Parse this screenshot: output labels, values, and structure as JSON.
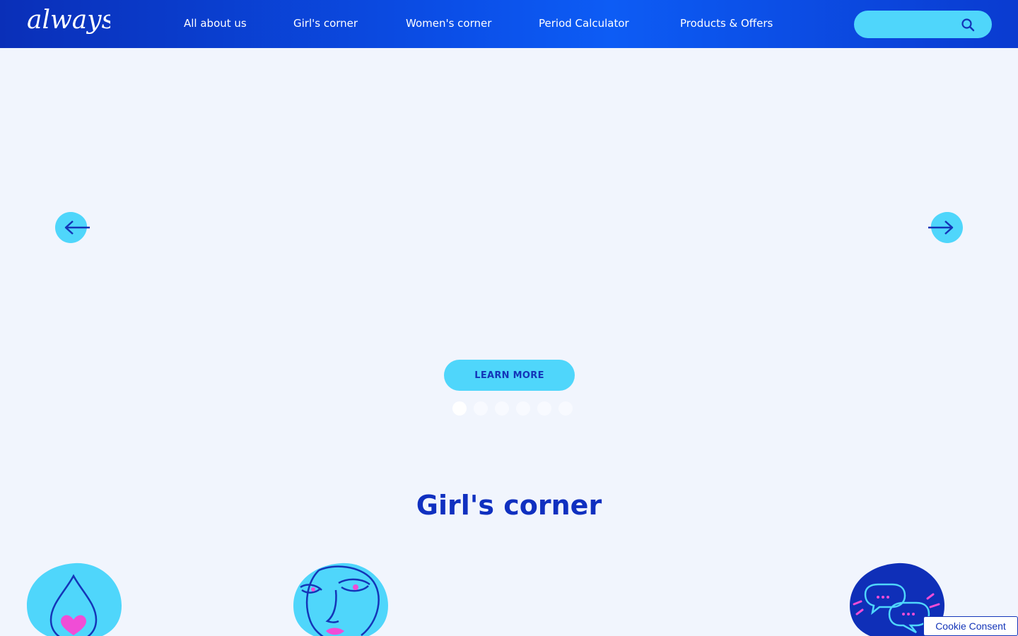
{
  "brand": {
    "logo_text": "always"
  },
  "nav": {
    "items": [
      {
        "label": "All about us"
      },
      {
        "label": "Girl's corner"
      },
      {
        "label": "Women's corner"
      },
      {
        "label": "Period Calculator"
      },
      {
        "label": "Products & Offers"
      }
    ]
  },
  "search": {
    "placeholder": ""
  },
  "hero": {
    "cta_label": "LEARN MORE",
    "slide_count": 6,
    "active_slide": 1
  },
  "section": {
    "title": "Girl's corner"
  },
  "cookie": {
    "label": "Cookie Consent"
  },
  "colors": {
    "brand_blue": "#1030c0",
    "accent_cyan": "#4fd6fb",
    "accent_pink": "#f04dd6",
    "page_bg": "#f1f5fd"
  }
}
